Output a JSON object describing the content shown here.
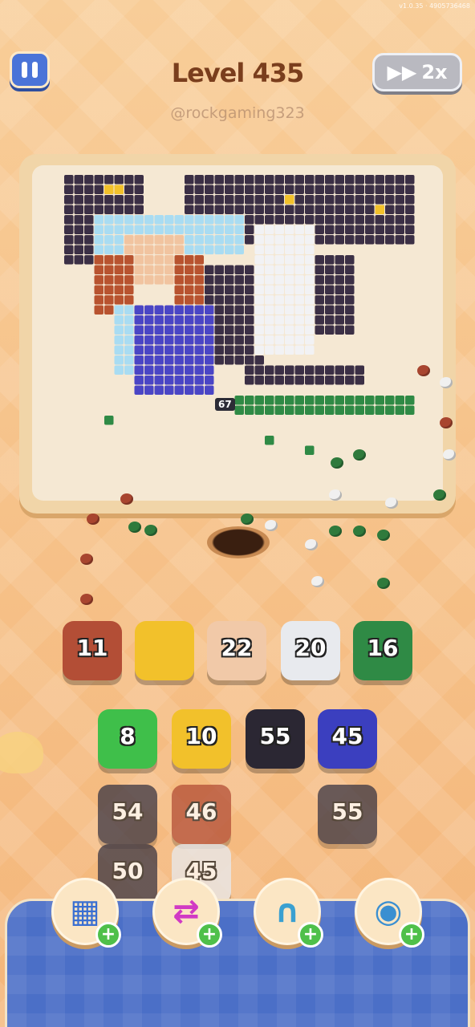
{
  "header": {
    "version_text": "v1.0.35 · 4905736468",
    "level_title": "Level 435",
    "watermark": "@rockgaming323",
    "speed_label": "2x"
  },
  "board": {
    "progress_badge": "67"
  },
  "queue_tiles": [
    {
      "count": "11",
      "color": "#b34e36"
    },
    {
      "count": "",
      "color": "#f2c12b"
    },
    {
      "count": "22",
      "color": "#f1c9a8"
    },
    {
      "count": "20",
      "color": "#e8eaee"
    },
    {
      "count": "16",
      "color": "#2f8a45"
    }
  ],
  "grid_tiles": [
    {
      "count": "8",
      "color": "#3fbf4a"
    },
    {
      "count": "10",
      "color": "#f2c12b"
    },
    {
      "count": "55",
      "color": "#2b2733"
    },
    {
      "count": "45",
      "color": "#3b3fbf"
    },
    {
      "count": "54",
      "color": "#3a3542"
    },
    {
      "count": "46",
      "color": "#b34e36"
    },
    {
      "count": "55",
      "color": "#3a3542"
    },
    {
      "count": "50",
      "color": "#3a3542"
    },
    {
      "count": "45",
      "color": "#e8eaee"
    }
  ],
  "boosters": [
    {
      "icon": "add-slot-icon",
      "plus": "+"
    },
    {
      "icon": "swap-arrows-icon",
      "plus": "+"
    },
    {
      "icon": "magnet-icon",
      "plus": "+"
    },
    {
      "icon": "eraser-icon",
      "plus": "+"
    }
  ]
}
